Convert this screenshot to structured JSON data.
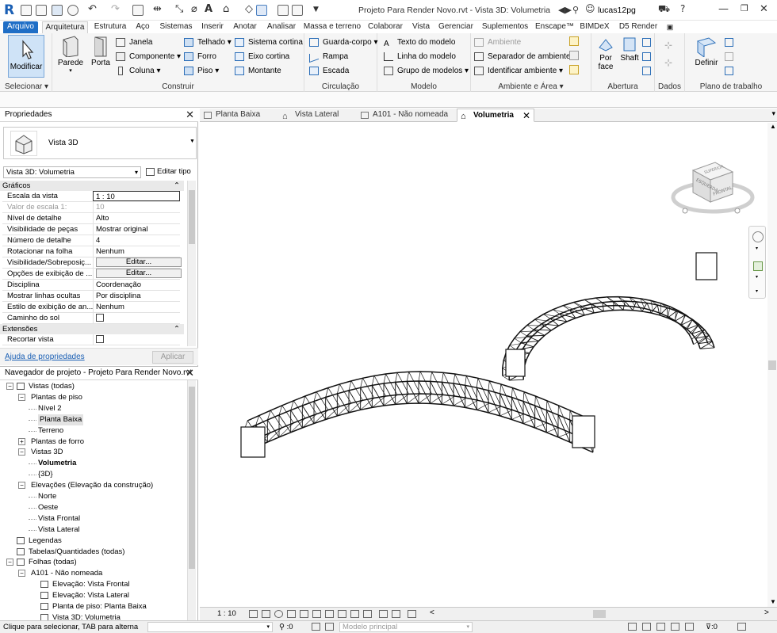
{
  "app": {
    "logo_letter": "R",
    "document_title": "Projeto Para Render Novo.rvt - Vista 3D: Volumetria",
    "user_name": "lucas12pg"
  },
  "menu_tabs": [
    {
      "label": "Arquivo"
    },
    {
      "label": "Arquitetura"
    },
    {
      "label": "Estrutura"
    },
    {
      "label": "Aço"
    },
    {
      "label": "Sistemas"
    },
    {
      "label": "Inserir"
    },
    {
      "label": "Anotar"
    },
    {
      "label": "Analisar"
    },
    {
      "label": "Massa e terreno"
    },
    {
      "label": "Colaborar"
    },
    {
      "label": "Vista"
    },
    {
      "label": "Gerenciar"
    },
    {
      "label": "Suplementos"
    },
    {
      "label": "Enscape™"
    },
    {
      "label": "BIMDeX"
    },
    {
      "label": "D5 Render"
    }
  ],
  "ribbon": {
    "select": {
      "modify_label": "Modificar",
      "group_label": "Selecionar"
    },
    "build": {
      "group_label": "Construir",
      "parede": "Parede",
      "porta": "Porta",
      "janela": "Janela",
      "componente": "Componente",
      "coluna": "Coluna",
      "telhado": "Telhado",
      "forro": "Forro",
      "piso": "Piso",
      "sistema_cortina": "Sistema cortina",
      "eixo_cortina": "Eixo cortina",
      "montante": "Montante"
    },
    "circulation": {
      "group_label": "Circulação",
      "guarda_corpo": "Guarda-corpo",
      "rampa": "Rampa",
      "escada": "Escada"
    },
    "model": {
      "group_label": "Modelo",
      "texto": "Texto do modelo",
      "linha": "Linha do modelo",
      "grupo": "Grupo de modelos"
    },
    "room": {
      "group_label": "Ambiente e Área",
      "ambiente": "Ambiente",
      "separador": "Separador de ambiente",
      "identificar": "Identificar ambiente"
    },
    "opening": {
      "group_label": "Abertura",
      "por_face": "Por face",
      "shaft": "Shaft"
    },
    "datum": {
      "group_label": "Dados"
    },
    "workplane": {
      "group_label": "Plano de trabalho",
      "definir": "Definir"
    }
  },
  "properties": {
    "panel_title": "Propriedades",
    "type_name": "Vista 3D",
    "instance_selector": "Vista 3D: Volumetria",
    "edit_type": "Editar tipo",
    "section_graphics": "Gráficos",
    "rows": [
      {
        "key": "Escala da vista",
        "value": "1 : 10"
      },
      {
        "key": "Valor de escala    1:",
        "value": "10"
      },
      {
        "key": "Nível de detalhe",
        "value": "Alto"
      },
      {
        "key": "Visibilidade de peças",
        "value": "Mostrar original"
      },
      {
        "key": "Número de detalhe",
        "value": "4"
      },
      {
        "key": "Rotacionar na folha",
        "value": "Nenhum"
      },
      {
        "key": "Visibilidade/Sobreposiç...",
        "value": "Editar..."
      },
      {
        "key": "Opções de exibição de ...",
        "value": "Editar..."
      },
      {
        "key": "Disciplina",
        "value": "Coordenação"
      },
      {
        "key": "Mostrar linhas ocultas",
        "value": "Por disciplina"
      },
      {
        "key": "Estilo de exibição de an...",
        "value": "Nenhum"
      },
      {
        "key": "Caminho do sol",
        "value": ""
      }
    ],
    "section_extents": "Extensões",
    "crop_view": "Recortar vista",
    "help_link": "Ajuda de propriedades",
    "apply": "Aplicar"
  },
  "browser": {
    "panel_title": "Navegador de projeto - Projeto Para Render Novo.rvt",
    "items": [
      {
        "label": "Vistas (todas)"
      },
      {
        "label": "Plantas de piso"
      },
      {
        "label": "Nível 2"
      },
      {
        "label": "Planta Baixa"
      },
      {
        "label": "Terreno"
      },
      {
        "label": "Plantas de forro"
      },
      {
        "label": "Vistas 3D"
      },
      {
        "label": "Volumetria"
      },
      {
        "label": "{3D}"
      },
      {
        "label": "Elevações (Elevação da construção)"
      },
      {
        "label": "Norte"
      },
      {
        "label": "Oeste"
      },
      {
        "label": "Vista Frontal"
      },
      {
        "label": "Vista Lateral"
      },
      {
        "label": "Legendas"
      },
      {
        "label": "Tabelas/Quantidades (todas)"
      },
      {
        "label": "Folhas (todas)"
      },
      {
        "label": "A101 - Não nomeada"
      },
      {
        "label": "Elevação: Vista Frontal"
      },
      {
        "label": "Elevação: Vista Lateral"
      },
      {
        "label": "Planta de piso: Planta Baixa"
      },
      {
        "label": "Vista 3D: Volumetria"
      }
    ]
  },
  "view_tabs": [
    {
      "label": "Planta Baixa"
    },
    {
      "label": "Vista Lateral"
    },
    {
      "label": "A101 - Não nomeada"
    },
    {
      "label": "Volumetria"
    }
  ],
  "viewcube": {
    "face_front": "FRONTAL",
    "face_left": "ESQUERDA",
    "face_top": "SUPERIOR"
  },
  "view_control": {
    "scale": "1 : 10"
  },
  "status": {
    "hint": "Clique para selecionar, TAB para alterna",
    "coord": ":0",
    "model": "Modelo principal",
    "filter_count": ":0"
  }
}
